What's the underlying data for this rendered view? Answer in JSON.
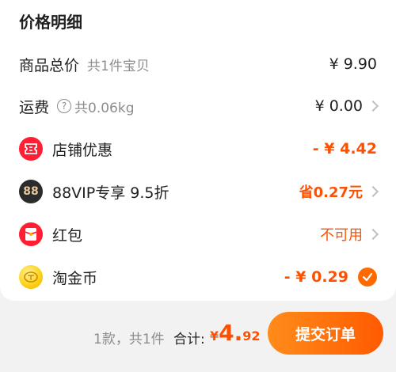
{
  "title": "价格明细",
  "rows": {
    "goods": {
      "label": "商品总价",
      "sub": "共1件宝贝",
      "value": "¥ 9.90"
    },
    "shipping": {
      "label": "运费",
      "help": "?",
      "sub": "共0.06kg",
      "value": "¥ 0.00"
    },
    "store_discount": {
      "label": "店铺优惠",
      "value": "- ¥ 4.42",
      "icon": "coupon-icon",
      "icon_color": "#ff1e32"
    },
    "vip": {
      "badge": "88",
      "label": "88VIP专享 9.5折",
      "value": "省0.27元",
      "icon": "88vip-icon",
      "icon_color": "#2b2b2b"
    },
    "red_packet": {
      "label": "红包",
      "value": "不可用",
      "icon": "red-packet-icon",
      "icon_color": "#ff1e32"
    },
    "coins": {
      "label": "淘金币",
      "value": "- ¥ 0.29",
      "icon": "gold-coin-icon",
      "checked": true
    }
  },
  "footer": {
    "count": "1款，共1件",
    "total_label": "合计:",
    "total_currency": "¥",
    "total_int": "4.",
    "total_dec": "92",
    "submit_label": "提交订单"
  },
  "colors": {
    "accent": "#ff5000",
    "button_gradient_start": "#ff8c1a",
    "button_gradient_end": "#ff5a00"
  }
}
